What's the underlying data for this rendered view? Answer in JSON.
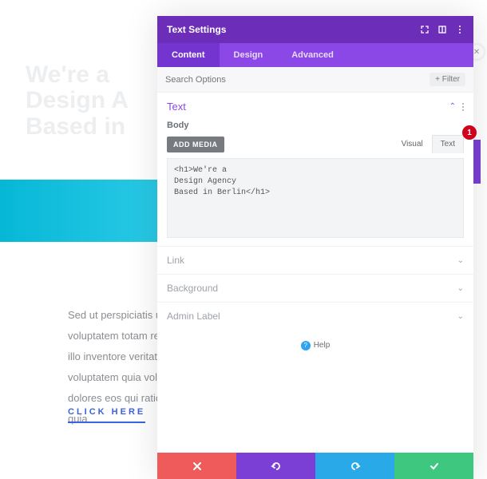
{
  "background": {
    "heading_line1": "We're a",
    "heading_line2": "Design A",
    "heading_line3": "Based in",
    "paragraph": "Sed ut perspiciatis unde omnis iste natus error sit voluptatem totam rem aperiam, eaque ipsa quae ab illo inventore veritatis explicabo. Nemo enim ipsam voluptatem quia voluptas sit consequuntur magni dolores eos qui ratione voluptatem dolorem ipsum quia",
    "cta": "CLICK HERE"
  },
  "modal": {
    "title": "Text Settings",
    "tabs": {
      "content": "Content",
      "design": "Design",
      "advanced": "Advanced"
    },
    "search": {
      "placeholder": "Search Options",
      "filter": "Filter"
    },
    "section_text": "Text",
    "body_label": "Body",
    "add_media": "ADD MEDIA",
    "vt": {
      "visual": "Visual",
      "text": "Text"
    },
    "code": "<h1>We're a\nDesign Agency\nBased in Berlin</h1>",
    "sections": {
      "link": "Link",
      "background": "Background",
      "admin": "Admin Label"
    },
    "help": "Help",
    "badge": "1"
  }
}
